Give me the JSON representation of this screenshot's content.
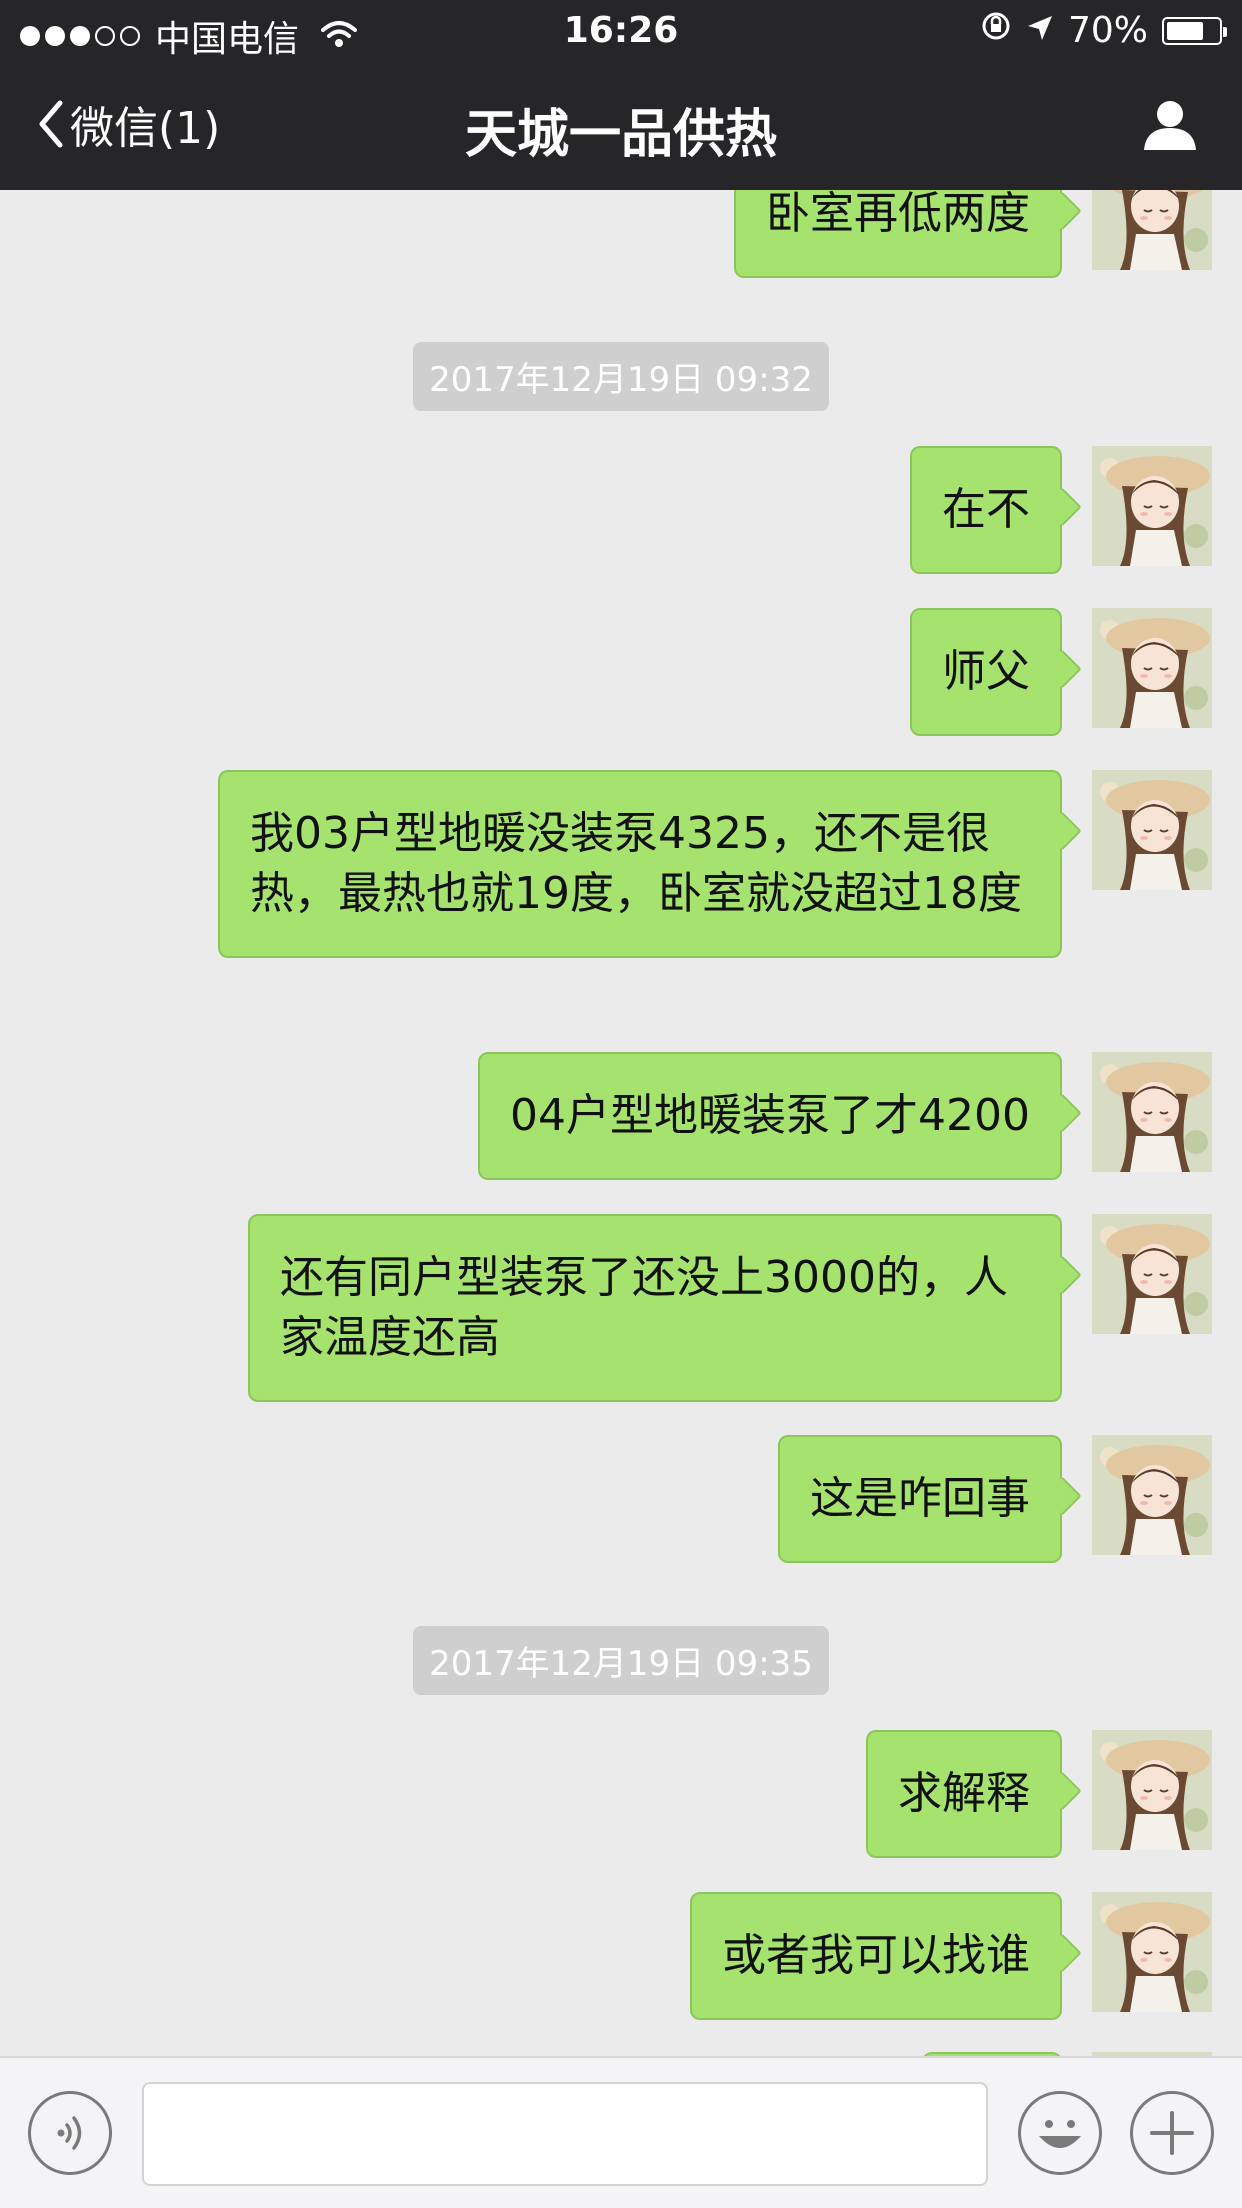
{
  "status_bar": {
    "carrier": "中国电信",
    "time": "16:26",
    "battery": "70%",
    "signal_bars_filled": 3,
    "signal_bars_total": 5
  },
  "nav": {
    "back_label": "微信(1)",
    "title": "天城一品供热"
  },
  "timestamps": [
    "2017年12月19日 09:32",
    "2017年12月19日 09:35"
  ],
  "messages": [
    {
      "text": "卧室再低两度"
    },
    {
      "text": "在不"
    },
    {
      "text": "师父"
    },
    {
      "text": "我03户型地暖没装泵4325，还不是很热，最热也就19度，卧室就没超过18度"
    },
    {
      "text": "04户型地暖装泵了才4200"
    },
    {
      "text": "还有同户型装泵了还没上3000的，人家温度还高"
    },
    {
      "text": "这是咋回事"
    },
    {
      "text": "求解释"
    },
    {
      "text": "或者我可以找谁"
    },
    {
      "text": ""
    }
  ],
  "input": {
    "value": ""
  },
  "colors": {
    "header_bg": "#262628",
    "chat_bg": "#ebebeb",
    "bubble_green": "#a6e36e"
  },
  "icons": {
    "back": "chevron-left-icon",
    "profile": "person-icon",
    "voice": "voice-icon",
    "emoji": "emoji-icon",
    "plus": "plus-icon"
  }
}
